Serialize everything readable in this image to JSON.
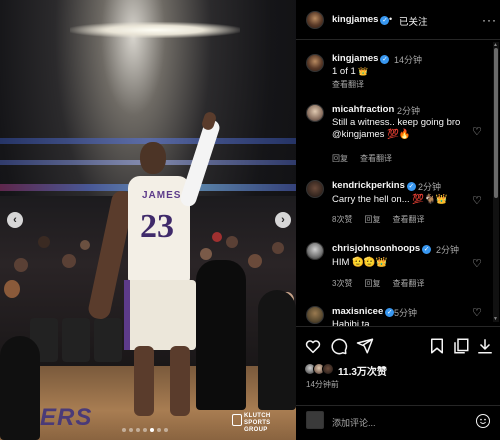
{
  "photo": {
    "jersey_name": "JAMES",
    "jersey_number": "23",
    "court_text": "ERS",
    "watermark_line1": "KLUTCH",
    "watermark_line2": "SPORTS",
    "watermark_line3": "GROUP",
    "prev_icon": "chevron-left-icon",
    "next_icon": "chevron-right-icon",
    "carousel": {
      "total": 7,
      "active": 4
    }
  },
  "header": {
    "username": "kingjames",
    "separator": "•",
    "follow_label": "已关注",
    "more_icon": "more-horizontal-icon",
    "more_glyph": "···"
  },
  "caption": {
    "username": "kingjames",
    "time": "14分钟",
    "text": "1 of 1",
    "emoji": "👑",
    "translate": "查看翻译"
  },
  "comments": [
    {
      "username": "micahfraction",
      "verified": false,
      "time": "2分钟",
      "line1": "Still a witness.. keep going bro",
      "line2": "@kingjames 💯🔥",
      "actions": [
        "回复",
        "查看翻译"
      ],
      "likes": ""
    },
    {
      "username": "kendrickperkins",
      "verified": true,
      "time": "2分钟",
      "line1": "Carry the hell on... 💯🐐👑",
      "line2": "",
      "actions": [
        "8次赞",
        "回复",
        "查看翻译"
      ],
      "likes": "8次赞"
    },
    {
      "username": "chrisjohnsonhoops",
      "verified": true,
      "time": "2分钟",
      "line1": "HIM 🫡🫡👑",
      "line2": "",
      "actions": [
        "3次赞",
        "回复",
        "查看翻译"
      ],
      "likes": "3次赞"
    },
    {
      "username": "maxisnicee",
      "verified": true,
      "time": "5分钟",
      "line1": "Habibi ta",
      "line2": "",
      "actions": [],
      "likes": ""
    }
  ],
  "actions": {
    "like_icon": "heart-icon",
    "comment_icon": "comment-icon",
    "share_icon": "send-icon",
    "save_icon": "bookmark-icon",
    "copy_icon": "copy-icon",
    "download_icon": "download-icon",
    "likes": "11.3万次赞",
    "post_time": "14分钟前"
  },
  "comment_box": {
    "placeholder": "添加评论...",
    "emoji_icon": "emoji-icon"
  },
  "colors": {
    "background": "#000000",
    "text": "#f5f5f5",
    "muted": "#a8a8a8",
    "verified": "#3897f0",
    "divider": "#262626"
  }
}
